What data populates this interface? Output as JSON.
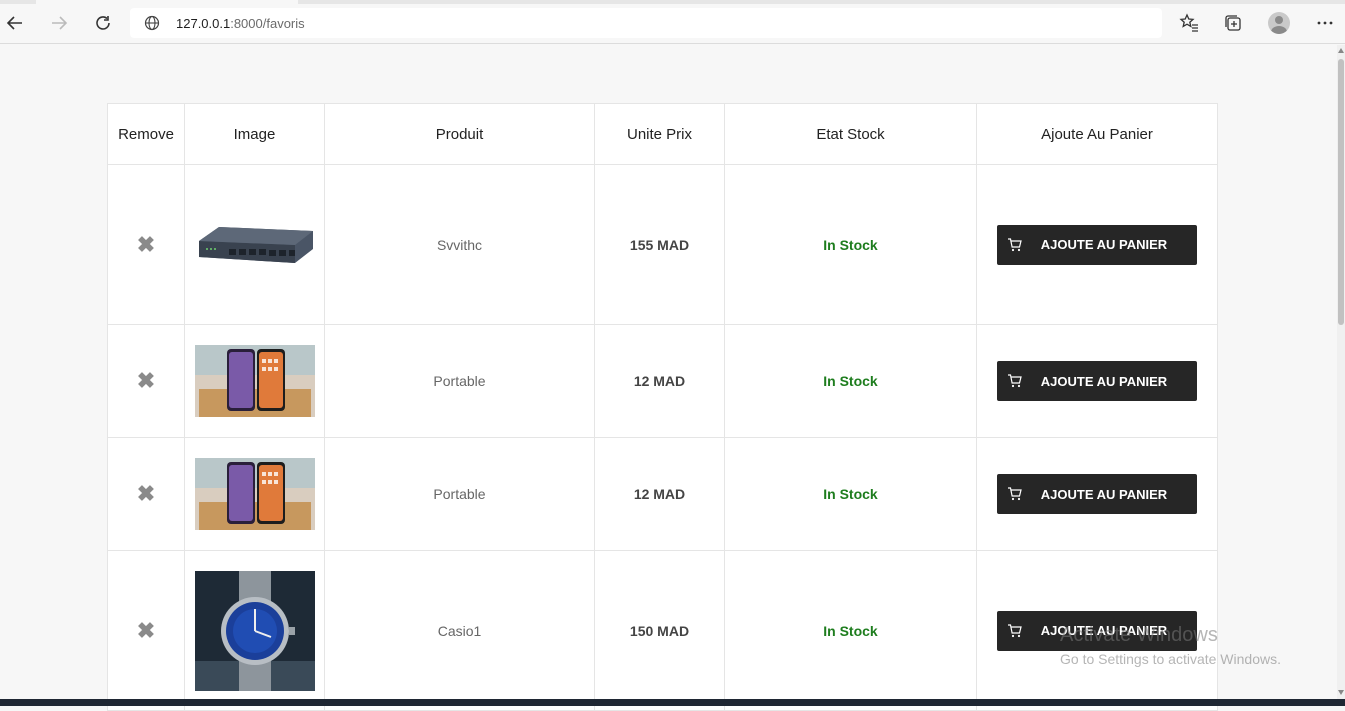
{
  "browser": {
    "url_host": "127.0.0.1",
    "url_path": ":8000/favoris"
  },
  "table": {
    "headers": [
      "Remove",
      "Image",
      "Produit",
      "Unite Prix",
      "Etat Stock",
      "Ajoute Au Panier"
    ],
    "rows": [
      {
        "remove_icon": "✖",
        "image": "network-switch-image",
        "product": "Svvithc",
        "price": "155 MAD",
        "stock": "In Stock",
        "button": "AJOUTE AU PANIER"
      },
      {
        "remove_icon": "✖",
        "image": "smartphones-image",
        "product": "Portable",
        "price": "12 MAD",
        "stock": "In Stock",
        "button": "AJOUTE AU PANIER"
      },
      {
        "remove_icon": "✖",
        "image": "smartphones-image",
        "product": "Portable",
        "price": "12 MAD",
        "stock": "In Stock",
        "button": "AJOUTE AU PANIER"
      },
      {
        "remove_icon": "✖",
        "image": "watch-image",
        "product": "Casio1",
        "price": "150 MAD",
        "stock": "In Stock",
        "button": "AJOUTE AU PANIER"
      }
    ]
  },
  "watermark": {
    "line1": "Activate Windows",
    "line2": "Go to Settings to activate Windows."
  },
  "colors": {
    "stock_green": "#1e7d1e",
    "button_dark": "#262626"
  }
}
